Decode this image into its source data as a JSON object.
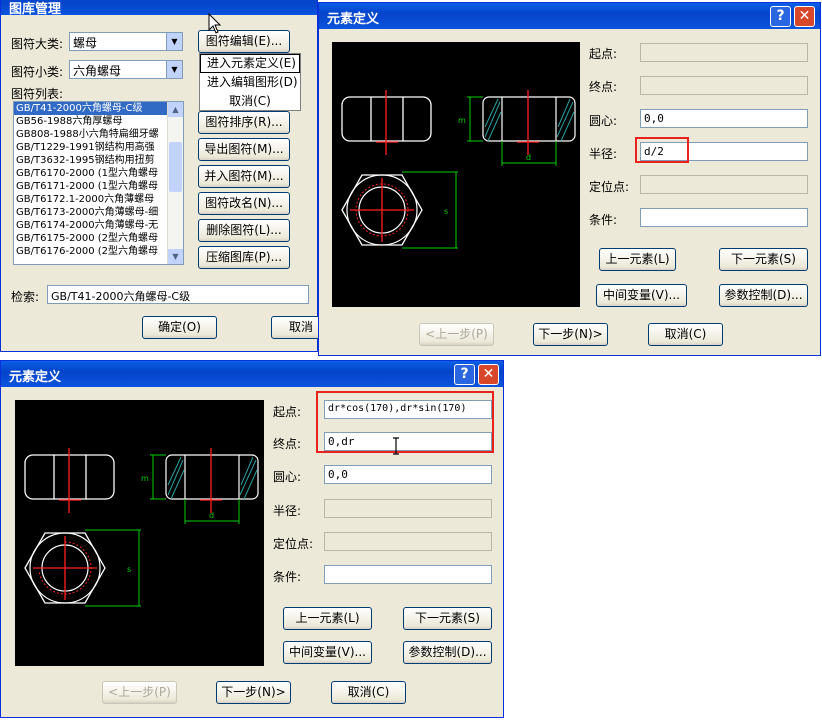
{
  "library": {
    "title": "图库管理",
    "category_label": "图符大类:",
    "category_value": "螺母",
    "subcategory_label": "图符小类:",
    "subcategory_value": "六角螺母",
    "list_label": "图符列表:",
    "list_items": [
      "GB/T41-2000六角螺母-C级",
      "GB56-1988六角厚螺母",
      "GB808-1988小六角特扁细牙螺",
      "GB/T1229-1991钢结构用高强",
      "GB/T3632-1995钢结构用扭剪",
      "GB/T6170-2000 (1型六角螺母",
      "GB/T6171-2000 (1型六角螺母",
      "GB/T6172.1-2000六角薄螺母",
      "GB/T6173-2000六角薄螺母-细",
      "GB/T6174-2000六角薄螺母-无",
      "GB/T6175-2000 (2型六角螺母",
      "GB/T6176-2000 (2型六角螺母"
    ],
    "buttons": [
      "图符编辑(E)...",
      "图符排序(R)...",
      "导出图符(M)...",
      "并入图符(M)...",
      "图符改名(N)...",
      "删除图符(L)...",
      "压缩图库(P)..."
    ],
    "popup_items": [
      "进入元素定义(E)",
      "进入编辑图形(D)",
      "取消(C)"
    ],
    "search_label": "检索:",
    "search_value": "GB/T41-2000六角螺母-C级",
    "ok_label": "确定(O)",
    "cancel_label": "取消"
  },
  "dialog1": {
    "title": "元素定义",
    "help": "?",
    "close": "✕",
    "start_label": "起点:",
    "start_value": "",
    "end_label": "终点:",
    "end_value": "",
    "center_label": "圆心:",
    "center_value": "0,0",
    "radius_label": "半径:",
    "radius_value": "d/2",
    "locate_label": "定位点:",
    "locate_value": "",
    "cond_label": "条件:",
    "cond_value": "",
    "prev_elem": "上一元素(L)",
    "next_elem": "下一元素(S)",
    "mid_var": "中间变量(V)...",
    "param_ctrl": "参数控制(D)...",
    "prev_step": "<上一步(P)",
    "next_step": "下一步(N)>",
    "cancel": "取消(C)",
    "dim_m": "m",
    "dim_d": "d",
    "dim_s": "s"
  },
  "dialog2": {
    "title": "元素定义",
    "help": "?",
    "close": "✕",
    "start_label": "起点:",
    "start_value": "dr*cos(170),dr*sin(170)",
    "end_label": "终点:",
    "end_value": "0,dr",
    "center_label": "圆心:",
    "center_value": "0,0",
    "radius_label": "半径:",
    "radius_value": "",
    "locate_label": "定位点:",
    "locate_value": "",
    "cond_label": "条件:",
    "cond_value": "",
    "prev_elem": "上一元素(L)",
    "next_elem": "下一元素(S)",
    "mid_var": "中间变量(V)...",
    "param_ctrl": "参数控制(D)...",
    "prev_step": "<上一步(P)",
    "next_step": "下一步(N)>",
    "cancel": "取消(C)",
    "dim_m": "m",
    "dim_d": "d",
    "dim_s": "s"
  },
  "colors": {
    "title_blue": "#0b54de",
    "highlight_red": "#e8231d",
    "dim_green": "#00d000",
    "center_red": "#ff2020"
  }
}
